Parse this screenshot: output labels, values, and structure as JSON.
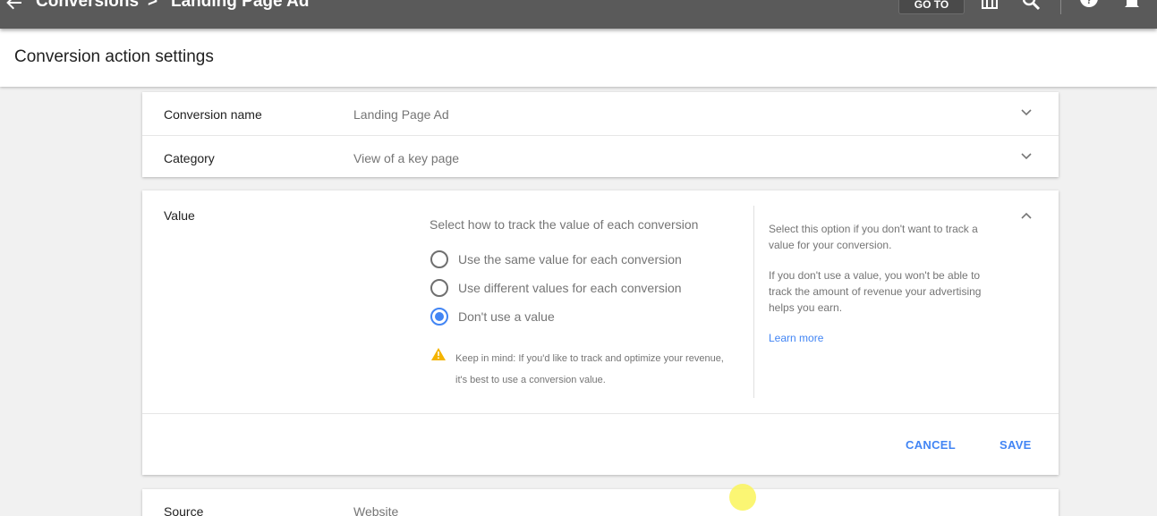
{
  "topbar": {
    "breadcrumb_parent": "Conversions",
    "separator": ">",
    "breadcrumb_current": "Landing Page Ad",
    "goto_label": "GO TO",
    "icons": [
      "back-arrow-icon",
      "chevron-right-icon",
      "tools-icon",
      "search-icon",
      "help-icon",
      "notifications-icon"
    ]
  },
  "page": {
    "title": "Conversion action settings"
  },
  "settings": {
    "conversion_name": {
      "label": "Conversion name",
      "value": "Landing Page Ad"
    },
    "category": {
      "label": "Category",
      "value": "View of a key page"
    },
    "value_section": {
      "label": "Value",
      "prompt": "Select how to track the value of each conversion",
      "options": [
        {
          "label": "Use the same value for each conversion",
          "selected": false
        },
        {
          "label": "Use different values for each conversion",
          "selected": false
        },
        {
          "label": "Don't use a value",
          "selected": true
        }
      ],
      "warning": "Keep in mind: If you'd like to track and optimize your revenue, it's best to use a conversion value.",
      "help_1": "Select this option if you don't want to track a value for your conversion.",
      "help_2": "If you don't use a value, you won't be able to track the amount of revenue your advertising helps you earn.",
      "learn_more": "Learn more",
      "cancel_label": "CANCEL",
      "save_label": "SAVE"
    },
    "source": {
      "label": "Source",
      "value": "Website"
    }
  },
  "colors": {
    "accent": "#4285f4",
    "topbar": "#5a5a5a",
    "warning": "#f4b400"
  }
}
